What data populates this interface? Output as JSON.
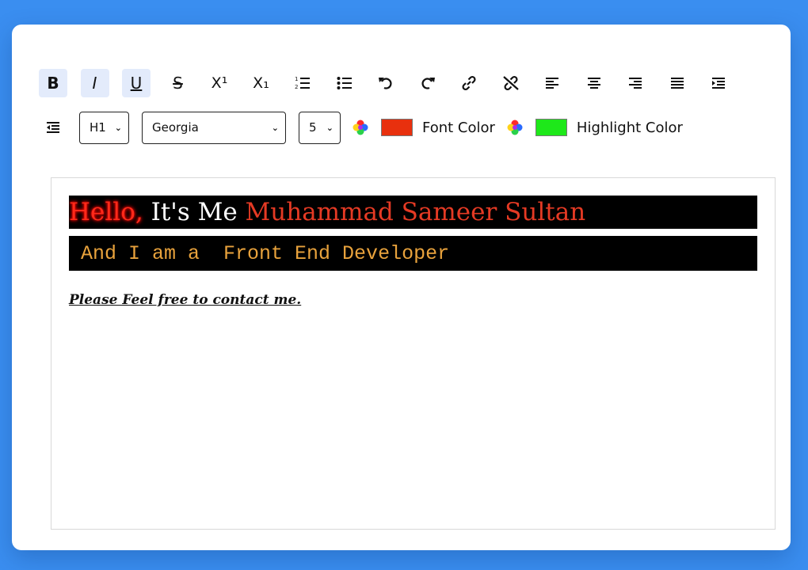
{
  "toolbar": {
    "buttons": [
      {
        "name": "bold-button",
        "label": "B",
        "active": true
      },
      {
        "name": "italic-button",
        "label": "I",
        "active": true
      },
      {
        "name": "underline-button",
        "label": "U",
        "active": true
      },
      {
        "name": "strikethrough-button",
        "label": "S",
        "active": false
      },
      {
        "name": "superscript-button",
        "label": "X¹",
        "active": false
      },
      {
        "name": "subscript-button",
        "label": "X₁",
        "active": false
      }
    ],
    "icon_buttons": [
      "ordered-list-icon",
      "unordered-list-icon",
      "undo-icon",
      "redo-icon",
      "link-icon",
      "unlink-icon",
      "align-left-icon",
      "align-center-icon",
      "align-right-icon",
      "justify-icon",
      "indent-icon"
    ]
  },
  "format": {
    "heading_value": "H1",
    "font_value": "Georgia",
    "size_value": "5",
    "font_color_label": "Font Color",
    "font_color": "#e8300e",
    "highlight_color_label": "Highlight Color",
    "highlight_color": "#1ee81a"
  },
  "content": {
    "heading_hello": "Hello,",
    "heading_white": " It's Me ",
    "heading_name": "Muhammad Sameer Sultan",
    "subheading": " And I am a  Front End Developer",
    "contact": "Please Feel free to contact me."
  },
  "colors": {
    "background": "#3a8ef0",
    "active_button": "#e3ebfb",
    "hello_red": "#ff2a1a",
    "name_red": "#e53a24",
    "subheading_orange": "#e8a23c"
  }
}
